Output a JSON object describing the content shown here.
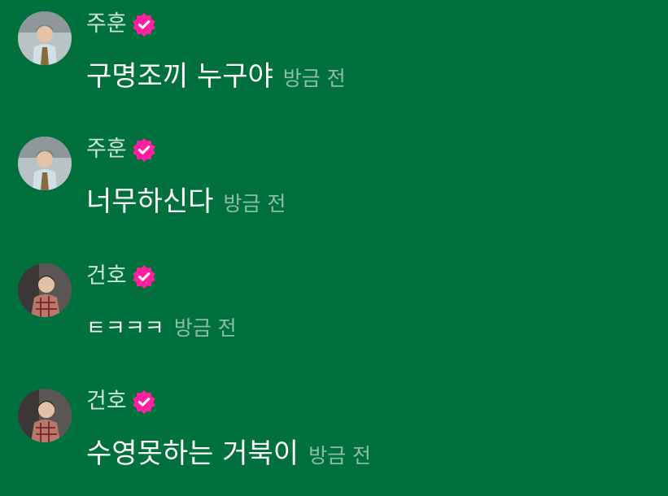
{
  "colors": {
    "background": "#00703c",
    "verified_badge": "#ff1fa0",
    "name_text": "#d6e9de",
    "message_text": "#ffffff",
    "time_text": "#8fc2a6"
  },
  "messages": [
    {
      "avatar_icon": "user-avatar-photo",
      "name": "주훈",
      "verified_icon": "verified-badge-icon",
      "text": "구명조끼 누구야",
      "time": "방금 전"
    },
    {
      "avatar_icon": "user-avatar-photo",
      "name": "주훈",
      "verified_icon": "verified-badge-icon",
      "text": "너무하신다",
      "time": "방금 전"
    },
    {
      "avatar_icon": "user-avatar-photo",
      "name": "건호",
      "verified_icon": "verified-badge-icon",
      "text": "ㅌㅋㅋㅋ",
      "time": "방금 전"
    },
    {
      "avatar_icon": "user-avatar-photo",
      "name": "건호",
      "verified_icon": "verified-badge-icon",
      "text": "수영못하는 거북이",
      "time": "방금 전"
    }
  ]
}
